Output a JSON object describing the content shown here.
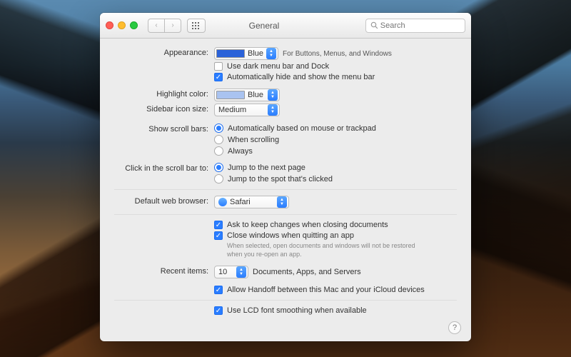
{
  "window": {
    "title": "General"
  },
  "search": {
    "placeholder": "Search"
  },
  "appearance": {
    "label": "Appearance:",
    "value": "Blue",
    "hint": "For Buttons, Menus, and Windows",
    "dark_menu": "Use dark menu bar and Dock",
    "autohide": "Automatically hide and show the menu bar",
    "dark_menu_checked": false,
    "autohide_checked": true
  },
  "highlight": {
    "label": "Highlight color:",
    "value": "Blue"
  },
  "sidebar": {
    "label": "Sidebar icon size:",
    "value": "Medium"
  },
  "scroll": {
    "label": "Show scroll bars:",
    "options": [
      {
        "text": "Automatically based on mouse or trackpad",
        "checked": true
      },
      {
        "text": "When scrolling",
        "checked": false
      },
      {
        "text": "Always",
        "checked": false
      }
    ]
  },
  "click_scroll": {
    "label": "Click in the scroll bar to:",
    "options": [
      {
        "text": "Jump to the next page",
        "checked": true
      },
      {
        "text": "Jump to the spot that's clicked",
        "checked": false
      }
    ]
  },
  "browser": {
    "label": "Default web browser:",
    "value": "Safari"
  },
  "docs": {
    "ask": "Ask to keep changes when closing documents",
    "close": "Close windows when quitting an app",
    "note": "When selected, open documents and windows will not be restored when you re-open an app."
  },
  "recent": {
    "label": "Recent items:",
    "value": "10",
    "suffix": "Documents, Apps, and Servers"
  },
  "handoff": {
    "text": "Allow Handoff between this Mac and your iCloud devices"
  },
  "lcd": {
    "text": "Use LCD font smoothing when available"
  }
}
